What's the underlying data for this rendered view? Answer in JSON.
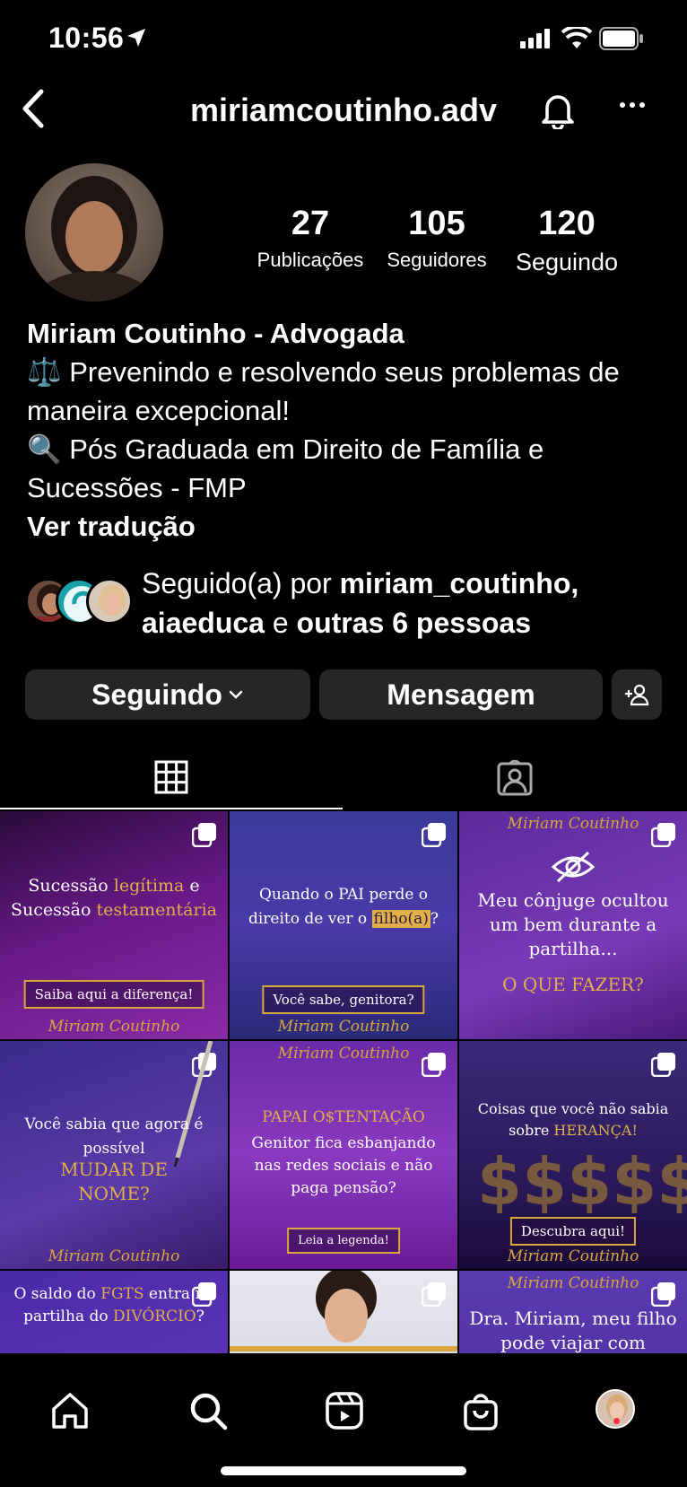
{
  "status_bar": {
    "time": "10:56"
  },
  "header": {
    "username": "miriamcoutinho.adv"
  },
  "stats": {
    "posts": {
      "value": "27",
      "label": "Publicações"
    },
    "followers": {
      "value": "105",
      "label": "Seguidores"
    },
    "following": {
      "value": "120",
      "label": "Seguindo"
    }
  },
  "bio": {
    "name": "Miriam Coutinho - Advogada",
    "line1": "⚖️ Prevenindo e resolvendo seus problemas de maneira excepcional!",
    "line2": "🔍 Pós Graduada em Direito de Família e Sucessões - FMP",
    "translate": "Ver tradução"
  },
  "followed_by": {
    "prefix": "Seguido(a) por ",
    "user1": "miriam_coutinho,",
    "user2": "aiaeduca",
    "middle": " e ",
    "others": "outras 6 pessoas"
  },
  "actions": {
    "following_label": "Seguindo",
    "message_label": "Mensagem"
  },
  "posts": {
    "p1": {
      "a": "Sucessão ",
      "b": "legítima",
      "c": " e Sucessão ",
      "d": "testamentária",
      "button": "Saiba aqui a diferença!",
      "sig": "Miriam Coutinho"
    },
    "p2": {
      "a": "Quando o PAI perde o direito de ver o ",
      "b": "filho(a)",
      "c": "?",
      "button": "Você sabe, genitora?",
      "sig": "Miriam Coutinho"
    },
    "p3": {
      "a": "Meu cônjuge ocultou um bem durante a partilha...",
      "b": "O QUE FAZER?",
      "sig": "Miriam Coutinho"
    },
    "p4": {
      "a": "Você sabia que agora é possível",
      "b": "MUDAR DE NOME?",
      "sig": "Miriam Coutinho"
    },
    "p5": {
      "a": "PAPAI O$TENTAÇÃO",
      "b": "Genitor fica esbanjando nas redes sociais e não paga pensão?",
      "button": "Leia a legenda!",
      "sig": "Miriam Coutinho"
    },
    "p6": {
      "a": "Coisas que você não sabia sobre ",
      "b": "HERANÇA!",
      "button": "Descubra aqui!",
      "sig": "Miriam Coutinho"
    },
    "p7": {
      "a": "O saldo do ",
      "b": "FGTS",
      "c": " entra na partilha do ",
      "d": "DIVÓRCIO",
      "e": "?"
    },
    "p9": {
      "a": "Dra. Miriam, meu filho pode viajar com",
      "sig": "Miriam Coutinho"
    }
  },
  "colors": {
    "background": "#000000",
    "button_bg": "#262626",
    "accent_gold": "#e2b04a",
    "notif": "#ff3040"
  }
}
